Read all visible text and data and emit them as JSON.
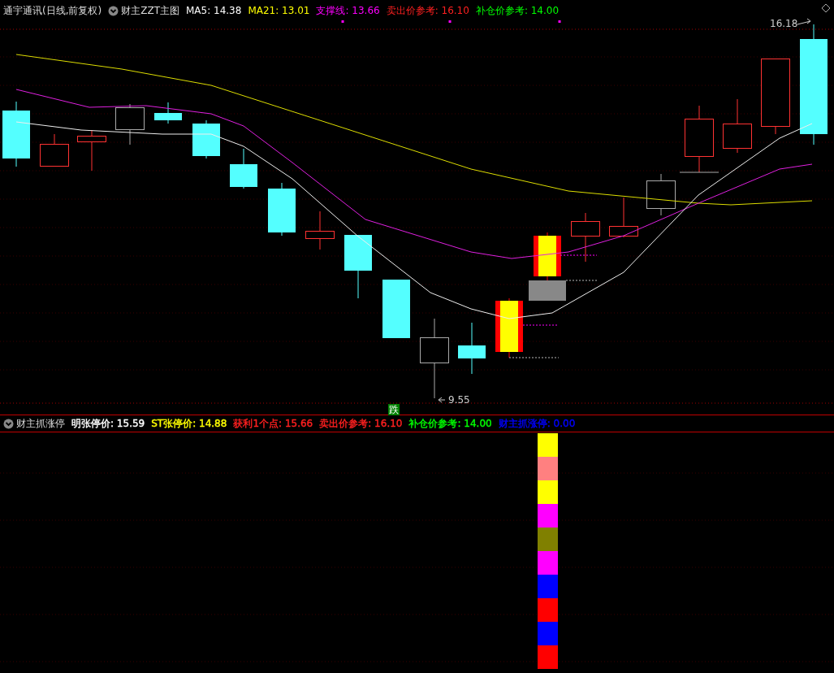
{
  "main_pane": {
    "stock_title": "通宇通讯(日线,前复权)",
    "indicator_name": "财主ZZT主图",
    "legend": [
      {
        "text": "MA5: 14.38",
        "color": "#ffffff"
      },
      {
        "text": "MA21: 13.01",
        "color": "#ffff00"
      },
      {
        "text": "支撑线: 13.66",
        "color": "#ff00ff"
      },
      {
        "text": "卖出价参考: 16.10",
        "color": "#ff2020"
      },
      {
        "text": "补仓价参考: 14.00",
        "color": "#00ff00"
      }
    ],
    "high_label": "16.18",
    "low_label": "9.55",
    "signal_label": "跌"
  },
  "sub_pane": {
    "indicator_name": "财主抓涨停",
    "legend": [
      {
        "text": "明张停价: 15.59",
        "color": "#ffffff"
      },
      {
        "text": "ST张停价: 14.88",
        "color": "#ffff00"
      },
      {
        "text": "获利1个点: 15.66",
        "color": "#ff2020"
      },
      {
        "text": "卖出价参考: 16.10",
        "color": "#ff2020"
      },
      {
        "text": "补仓价参考: 14.00",
        "color": "#00ff00"
      },
      {
        "text": "财主抓涨停: 0.00",
        "color": "#0000ff"
      }
    ],
    "signal_blocks": [
      {
        "color": "#ffff00"
      },
      {
        "color": "#ff8080"
      },
      {
        "color": "#ffff00"
      },
      {
        "color": "#ff00ff"
      },
      {
        "color": "#808000"
      },
      {
        "color": "#ff00ff"
      },
      {
        "color": "#0000ff"
      },
      {
        "color": "#ff0000"
      },
      {
        "color": "#0000ff"
      },
      {
        "color": "#ff0000"
      }
    ]
  }
}
